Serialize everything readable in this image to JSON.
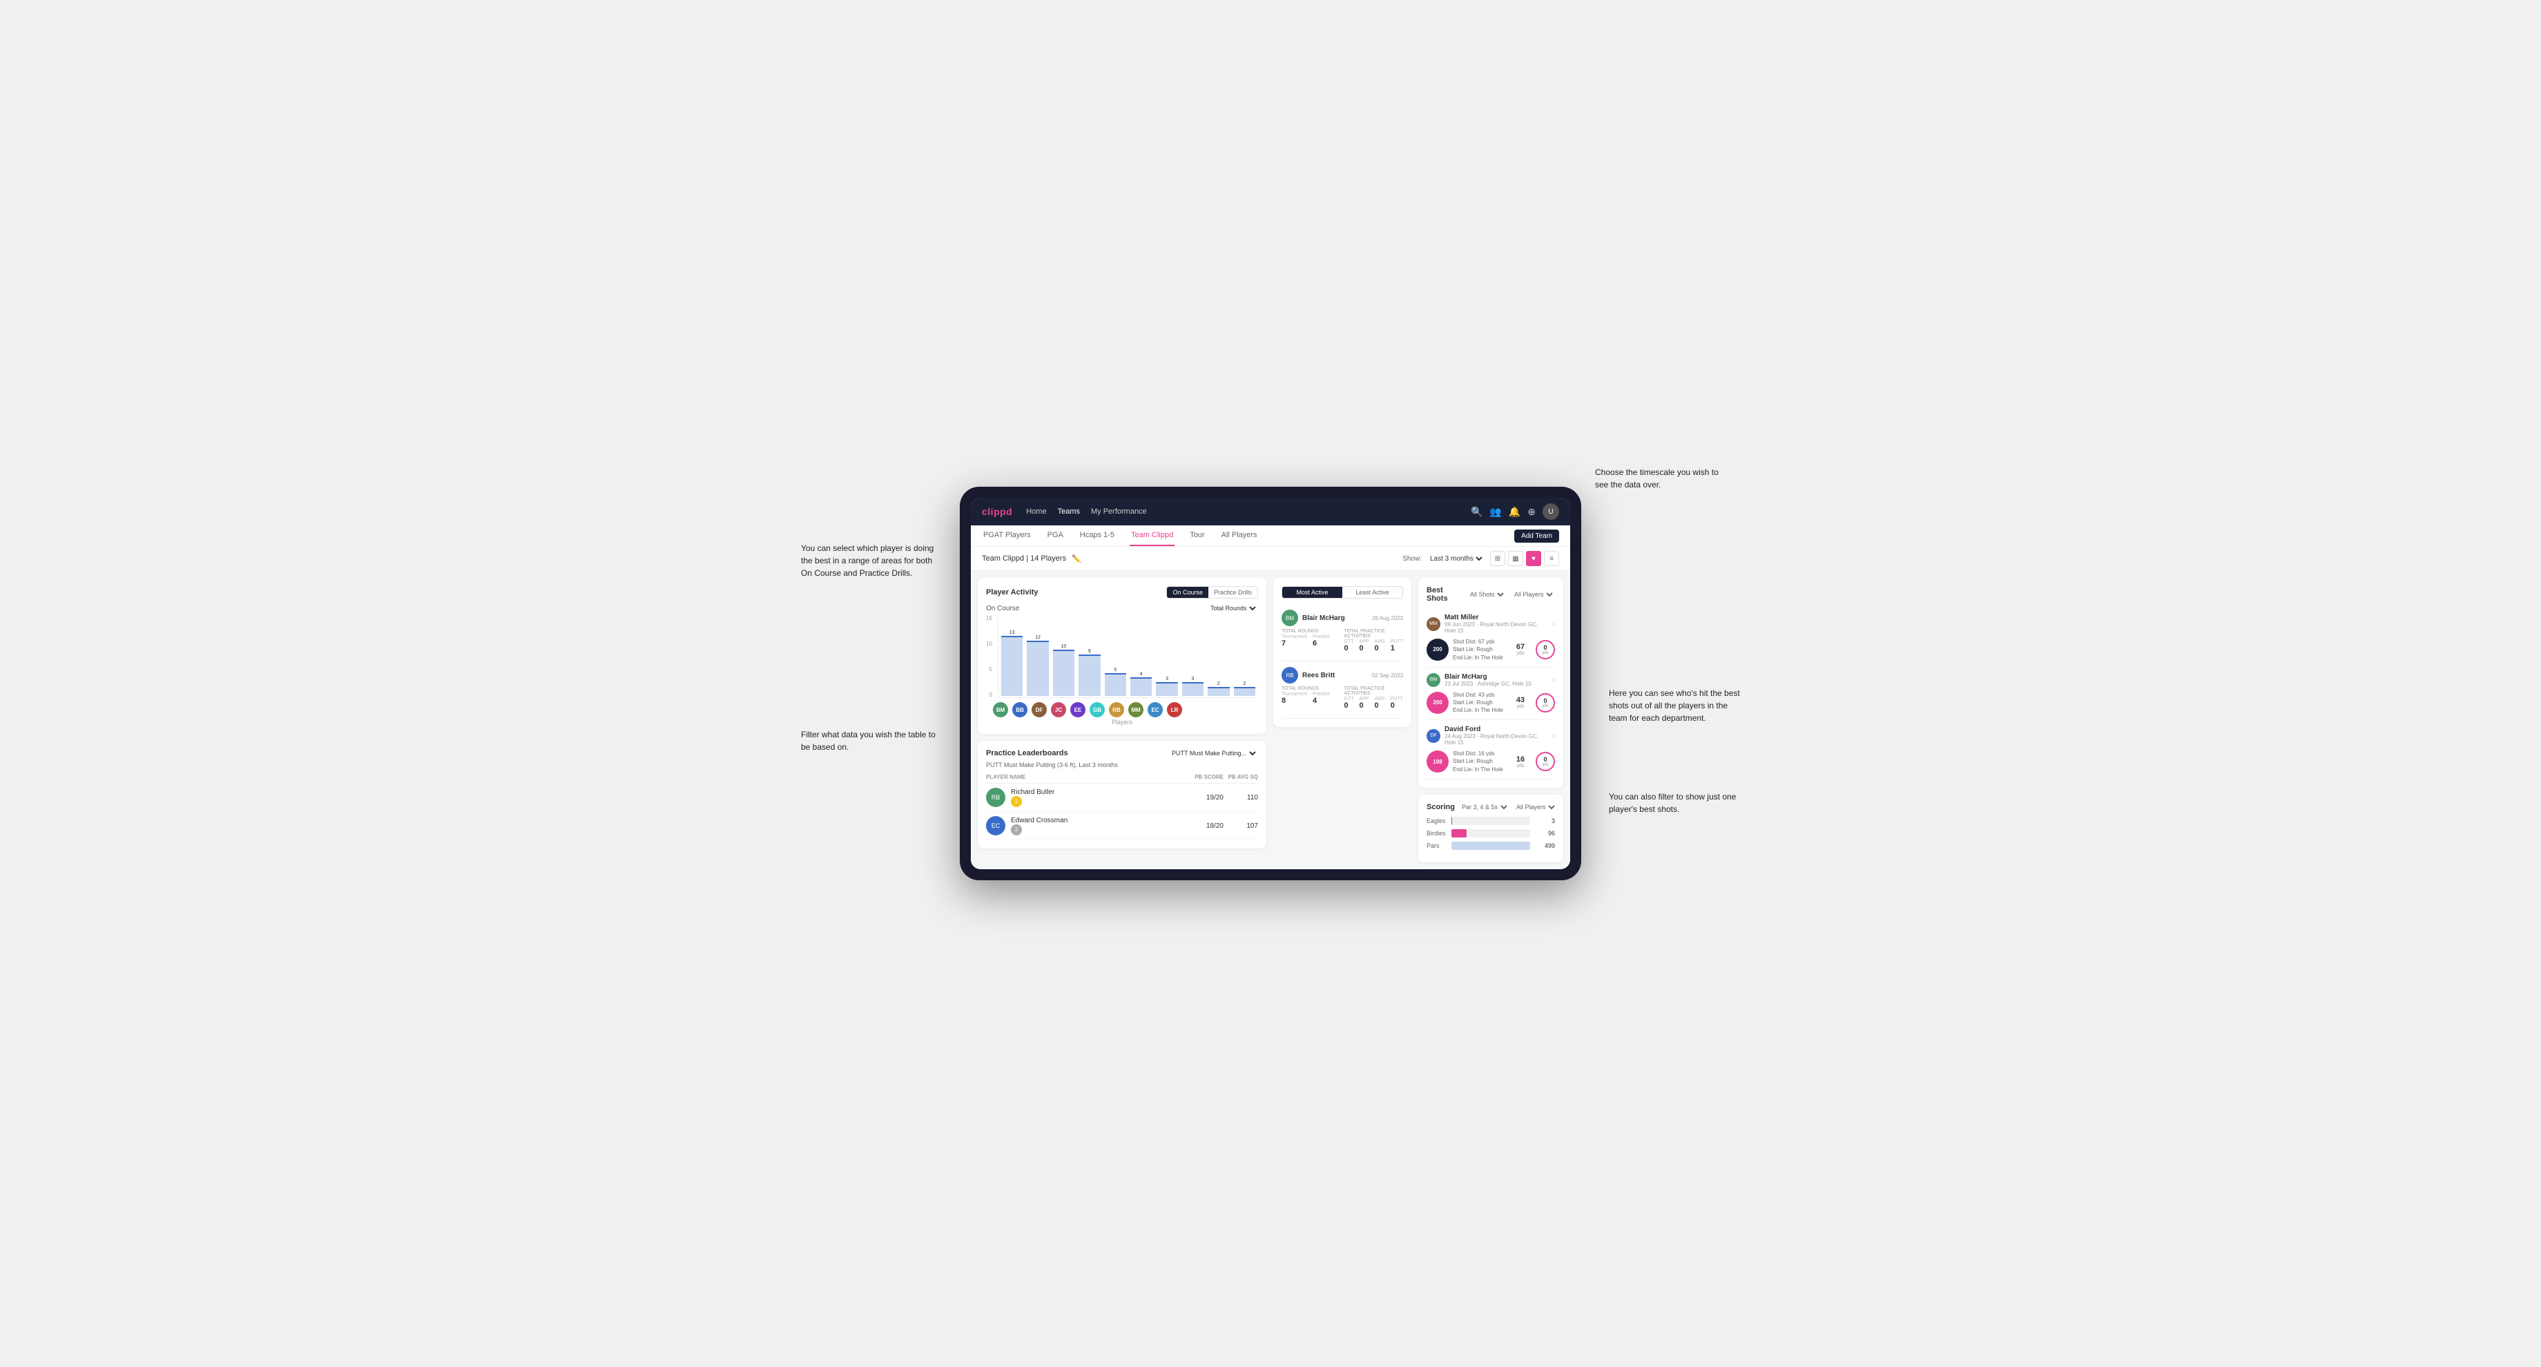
{
  "app": {
    "logo": "clippd",
    "nav": {
      "links": [
        "Home",
        "Teams",
        "My Performance"
      ],
      "active": "Teams"
    },
    "sub_nav": {
      "items": [
        "PGAT Players",
        "PGA",
        "Hcaps 1-5",
        "Team Clippd",
        "Tour",
        "All Players"
      ],
      "active": "Team Clippd"
    },
    "add_team_btn": "Add Team",
    "team_header": {
      "name": "Team Clippd | 14 Players",
      "show_label": "Show:",
      "show_value": "Last 3 months",
      "view_icons": [
        "grid-4",
        "grid-2",
        "heart",
        "list"
      ]
    }
  },
  "player_activity": {
    "title": "Player Activity",
    "toggle": [
      "On Course",
      "Practice Drills"
    ],
    "active_toggle": "On Course",
    "sub_title": "On Course",
    "chart_filter": "Total Rounds",
    "y_labels": [
      "15",
      "10",
      "5",
      "0"
    ],
    "bars": [
      {
        "label": "B. McHarg",
        "value": 13,
        "height": 90
      },
      {
        "label": "B. Britt",
        "value": 12,
        "height": 83
      },
      {
        "label": "D. Ford",
        "value": 10,
        "height": 70
      },
      {
        "label": "J. Coles",
        "value": 9,
        "height": 63
      },
      {
        "label": "E. Ebert",
        "value": 5,
        "height": 35
      },
      {
        "label": "G. Billingham",
        "value": 4,
        "height": 28
      },
      {
        "label": "R. Butler",
        "value": 3,
        "height": 21
      },
      {
        "label": "M. Miller",
        "value": 3,
        "height": 21
      },
      {
        "label": "E. Crossman",
        "value": 2,
        "height": 14
      },
      {
        "label": "L. Robertson",
        "value": 2,
        "height": 14
      }
    ],
    "x_axis_label": "Players",
    "y_axis_label": "Total Rounds",
    "avatar_colors": [
      "#4a9c6d",
      "#3a6bc8",
      "#8b5e3c",
      "#c84a6b",
      "#6b3ac8",
      "#3ac8c8",
      "#c8963a",
      "#6b8b3a",
      "#3a8bc8",
      "#c83a3a"
    ]
  },
  "practice_leaderboards": {
    "title": "Practice Leaderboards",
    "filter": "PUTT Must Make Putting...",
    "subtitle": "PUTT Must Make Putting (3-6 ft), Last 3 months",
    "cols": [
      "PLAYER NAME",
      "PB SCORE",
      "PB AVG SQ"
    ],
    "rows": [
      {
        "name": "Richard Butler",
        "score": "19/20",
        "avg": "110",
        "rank": 1,
        "color": "#4a9c6d"
      },
      {
        "name": "Edward Crossman",
        "score": "18/20",
        "avg": "107",
        "rank": 2,
        "color": "#3a6bc8"
      }
    ]
  },
  "most_active": {
    "toggle": [
      "Most Active",
      "Least Active"
    ],
    "active_toggle": "Most Active",
    "players": [
      {
        "name": "Blair McHarg",
        "date": "26 Aug 2023",
        "color": "#4a9c6d",
        "total_rounds_label": "Total Rounds",
        "tournament_label": "Tournament",
        "practice_label": "Practice",
        "tournament_val": "7",
        "practice_val": "6",
        "total_practice_label": "Total Practice Activities",
        "gtt_label": "GTT",
        "app_label": "APP",
        "arg_label": "ARG",
        "putt_label": "PUTT",
        "gtt_val": "0",
        "app_val": "0",
        "arg_val": "0",
        "putt_val": "1"
      },
      {
        "name": "Rees Britt",
        "date": "02 Sep 2023",
        "color": "#3a6bc8",
        "total_rounds_label": "Total Rounds",
        "tournament_label": "Tournament",
        "practice_label": "Practice",
        "tournament_val": "8",
        "practice_val": "4",
        "total_practice_label": "Total Practice Activities",
        "gtt_label": "GTT",
        "app_label": "APP",
        "arg_label": "ARG",
        "putt_label": "PUTT",
        "gtt_val": "0",
        "app_val": "0",
        "arg_val": "0",
        "putt_val": "0"
      }
    ]
  },
  "best_shots": {
    "title": "Best Shots",
    "shots_filter": "All Shots",
    "players_filter": "All Players",
    "players": [
      {
        "name": "Matt Miller",
        "date": "09 Jun 2023",
        "course": "Royal North Devon GC",
        "hole": "Hole 15",
        "color": "#8b5e3c",
        "sg": "200",
        "sg_color": "#1a2035",
        "shot_dist": "Shot Dist: 67 yds",
        "start_lie": "Start Lie: Rough",
        "end_lie": "End Lie: In The Hole",
        "metric1_val": "67",
        "metric1_unit": "yds",
        "metric2_val": "0",
        "metric2_unit": "yds"
      },
      {
        "name": "Blair McHarg",
        "date": "23 Jul 2023",
        "course": "Ashridge GC",
        "hole": "Hole 15",
        "color": "#4a9c6d",
        "sg": "200",
        "sg_color": "#e84393",
        "shot_dist": "Shot Dist: 43 yds",
        "start_lie": "Start Lie: Rough",
        "end_lie": "End Lie: In The Hole",
        "metric1_val": "43",
        "metric1_unit": "yds",
        "metric2_val": "0",
        "metric2_unit": "yds"
      },
      {
        "name": "David Ford",
        "date": "24 Aug 2023",
        "course": "Royal North Devon GC",
        "hole": "Hole 15",
        "color": "#3a6bc8",
        "sg": "198",
        "sg_color": "#e84393",
        "shot_dist": "Shot Dist: 16 yds",
        "start_lie": "Start Lie: Rough",
        "end_lie": "End Lie: In The Hole",
        "metric1_val": "16",
        "metric1_unit": "yds",
        "metric2_val": "0",
        "metric2_unit": "yds"
      }
    ]
  },
  "scoring": {
    "title": "Scoring",
    "filter1": "Par 3, 4 & 5s",
    "filter2": "All Players",
    "bars": [
      {
        "label": "Eagles",
        "value": 3,
        "max": 500,
        "color": "#3a6bc8"
      },
      {
        "label": "Birdies",
        "value": 96,
        "max": 500,
        "color": "#e84393"
      },
      {
        "label": "Pars",
        "value": 499,
        "max": 500,
        "color": "#c8d8f0"
      }
    ]
  },
  "annotations": {
    "top_right": "Choose the timescale you wish to see the data over.",
    "top_left": "You can select which player is doing the best in a range of areas for both On Course and Practice Drills.",
    "mid_left": "Filter what data you wish the table to be based on.",
    "mid_right": "Here you can see who's hit the best shots out of all the players in the team for each department.",
    "bot_right": "You can also filter to show just one player's best shots."
  }
}
